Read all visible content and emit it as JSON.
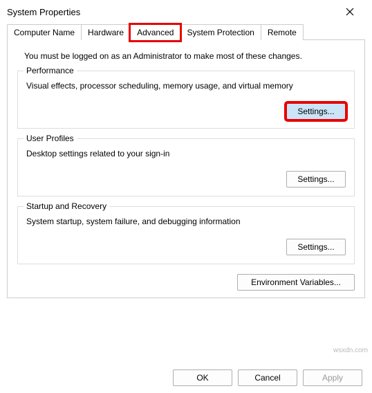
{
  "window": {
    "title": "System Properties"
  },
  "tabs": {
    "items": [
      {
        "label": "Computer Name"
      },
      {
        "label": "Hardware"
      },
      {
        "label": "Advanced"
      },
      {
        "label": "System Protection"
      },
      {
        "label": "Remote"
      }
    ]
  },
  "advanced": {
    "admin_note": "You must be logged on as an Administrator to make most of these changes.",
    "performance": {
      "legend": "Performance",
      "desc": "Visual effects, processor scheduling, memory usage, and virtual memory",
      "settings_label": "Settings..."
    },
    "user_profiles": {
      "legend": "User Profiles",
      "desc": "Desktop settings related to your sign-in",
      "settings_label": "Settings..."
    },
    "startup": {
      "legend": "Startup and Recovery",
      "desc": "System startup, system failure, and debugging information",
      "settings_label": "Settings..."
    },
    "env_vars_label": "Environment Variables..."
  },
  "buttons": {
    "ok": "OK",
    "cancel": "Cancel",
    "apply": "Apply"
  },
  "watermark": "wsxdn.com"
}
